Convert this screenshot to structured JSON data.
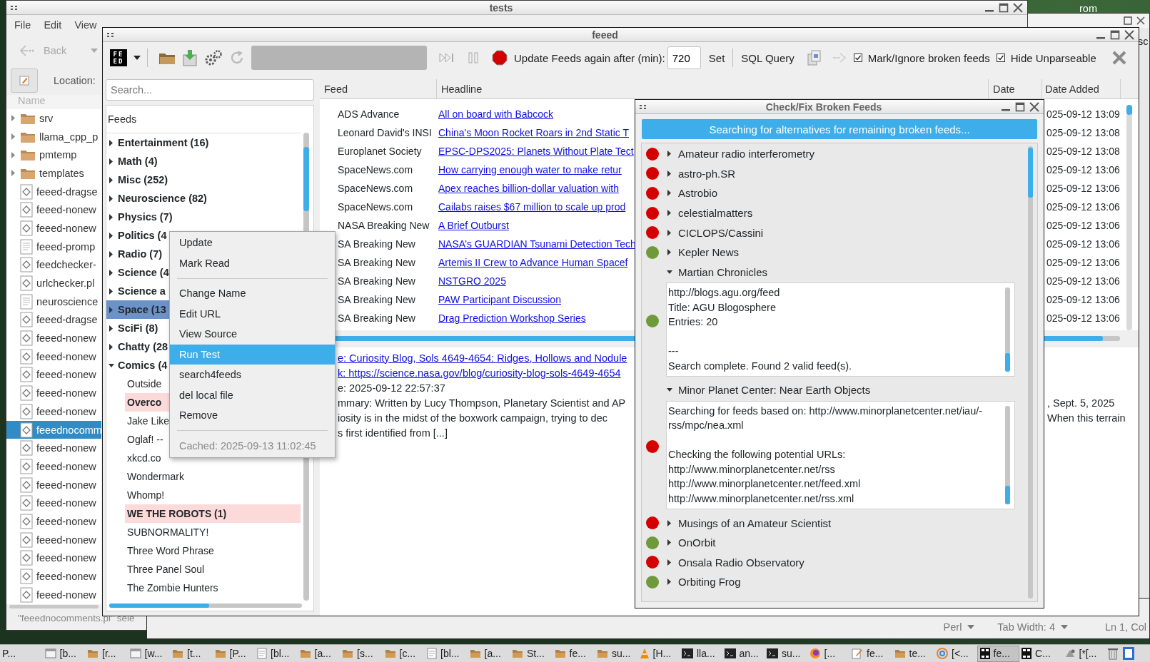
{
  "desktop": {
    "labels": [
      "rom",
      "sc"
    ]
  },
  "file_manager": {
    "title": "tests",
    "menu": [
      "File",
      "Edit",
      "View"
    ],
    "back_label": "Back",
    "location_label": "Location:",
    "column": "Name",
    "status": "\"feeednocomments.pl\" sele",
    "files": [
      {
        "name": "srv",
        "kind": "folder",
        "selected": false
      },
      {
        "name": "llama_cpp_p",
        "kind": "folder",
        "selected": false
      },
      {
        "name": "pmtemp",
        "kind": "folder",
        "selected": false
      },
      {
        "name": "templates",
        "kind": "folder",
        "selected": false
      },
      {
        "name": "feeed-dragse",
        "kind": "script",
        "selected": false
      },
      {
        "name": "feeed-nonew",
        "kind": "script",
        "selected": false
      },
      {
        "name": "feeed-nonew",
        "kind": "script",
        "selected": false
      },
      {
        "name": "feeed-promp",
        "kind": "text",
        "selected": false
      },
      {
        "name": "feedchecker-",
        "kind": "script",
        "selected": false
      },
      {
        "name": "urlchecker.pl",
        "kind": "script",
        "selected": false
      },
      {
        "name": "neuroscience",
        "kind": "text",
        "selected": false
      },
      {
        "name": "feeed-dragse",
        "kind": "script",
        "selected": false
      },
      {
        "name": "feeed-nonew",
        "kind": "script",
        "selected": false
      },
      {
        "name": "feeed-nonew",
        "kind": "script",
        "selected": false
      },
      {
        "name": "feeed-nonew",
        "kind": "script",
        "selected": false
      },
      {
        "name": "feeed-nonew",
        "kind": "script",
        "selected": false
      },
      {
        "name": "feeed-nonew",
        "kind": "script",
        "selected": false
      },
      {
        "name": "feeednocomm",
        "kind": "script",
        "selected": true
      },
      {
        "name": "feeed-nonew",
        "kind": "script",
        "selected": false
      },
      {
        "name": "feeed-nonew",
        "kind": "script",
        "selected": false
      },
      {
        "name": "feeed-nonew",
        "kind": "script",
        "selected": false
      },
      {
        "name": "feeed-nonew",
        "kind": "script",
        "selected": false
      },
      {
        "name": "feeed-nonew",
        "kind": "script",
        "selected": false
      },
      {
        "name": "feeed-nonew",
        "kind": "script",
        "selected": false
      },
      {
        "name": "feeed-nonew",
        "kind": "script",
        "selected": false
      },
      {
        "name": "feeed-nonew",
        "kind": "script",
        "selected": false
      },
      {
        "name": "feeed-nonew",
        "kind": "script",
        "selected": false
      }
    ]
  },
  "editor": {
    "syntax": "Perl",
    "tab_width": "Tab Width: 4",
    "cursor": "Ln 1, Col"
  },
  "feeed": {
    "title": "feeed",
    "logo": [
      "FE",
      "ED"
    ],
    "update_label": "Update Feeds again after (min):",
    "interval": "720",
    "set_button": "Set",
    "sql_button": "SQL Query",
    "checkboxes": [
      {
        "label": "Mark/Ignore broken feeds",
        "checked": true
      },
      {
        "label": "Hide Unparseable",
        "checked": true
      }
    ],
    "search": {
      "placeholder": "Search..."
    },
    "tree_header": "Feeds",
    "categories": [
      {
        "label": "Entertainment (16)",
        "expanded": false,
        "selected": false
      },
      {
        "label": "Math (4)",
        "expanded": false,
        "selected": false
      },
      {
        "label": "Misc (252)",
        "expanded": false,
        "selected": false
      },
      {
        "label": "Neuroscience (82)",
        "expanded": false,
        "selected": false
      },
      {
        "label": "Physics (7)",
        "expanded": false,
        "selected": false
      },
      {
        "label": "Politics (4",
        "expanded": false,
        "selected": false
      },
      {
        "label": "Radio (7)",
        "expanded": false,
        "selected": false
      },
      {
        "label": "Science (4",
        "expanded": false,
        "selected": false
      },
      {
        "label": "Science a",
        "expanded": false,
        "selected": false
      },
      {
        "label": "Space (13",
        "expanded": false,
        "selected": true
      },
      {
        "label": "SciFi (8)",
        "expanded": false,
        "selected": false
      },
      {
        "label": "Chatty (28",
        "expanded": false,
        "selected": false
      },
      {
        "label": "Comics (4",
        "expanded": true,
        "selected": false,
        "children": [
          {
            "label": "Outside",
            "unread": false,
            "flagged": false,
            "selected": false
          },
          {
            "label": "Overco",
            "unread": true,
            "flagged": true,
            "selected": false
          },
          {
            "label": "Jake Like",
            "unread": false,
            "flagged": false,
            "selected": false
          },
          {
            "label": "Oglaf! --",
            "unread": false,
            "flagged": false,
            "selected": false
          },
          {
            "label": "xkcd.co",
            "unread": false,
            "flagged": false,
            "selected": false
          },
          {
            "label": "Wondermark",
            "unread": false,
            "flagged": false,
            "selected": false
          },
          {
            "label": "Whomp!",
            "unread": false,
            "flagged": false,
            "selected": false
          },
          {
            "label": "WE THE ROBOTS (1)",
            "unread": true,
            "flagged": true,
            "selected": false
          },
          {
            "label": "SUBNORMALITY!",
            "unread": false,
            "flagged": false,
            "selected": false
          },
          {
            "label": "Three Word Phrase",
            "unread": false,
            "flagged": false,
            "selected": false
          },
          {
            "label": "Three Panel Soul",
            "unread": false,
            "flagged": false,
            "selected": false
          },
          {
            "label": "The Zombie Hunters",
            "unread": false,
            "flagged": false,
            "selected": false
          }
        ]
      }
    ],
    "columns": [
      "Feed",
      "Headline",
      "Date",
      "Date Added"
    ],
    "rows": [
      {
        "feed": "ADS Advance",
        "headline": "All on board with Babcock",
        "date_added": "025-09-12 13:09"
      },
      {
        "feed": "Leonard David's INSI",
        "headline": "China's Moon Rocket Roars in 2nd Static T",
        "date_added": "025-09-12 13:08"
      },
      {
        "feed": "Europlanet Society",
        "headline": "EPSC-DPS2025: Planets Without Plate Tect",
        "date_added": "025-09-12 13:08"
      },
      {
        "feed": "SpaceNews.com",
        "headline": "How carrying enough water to make retur",
        "date_added": "025-09-12 13:06"
      },
      {
        "feed": "SpaceNews.com",
        "headline": "Apex reaches billion-dollar valuation with",
        "date_added": "025-09-12 13:06"
      },
      {
        "feed": "SpaceNews.com",
        "headline": "Cailabs raises $67 million to scale up prod",
        "date_added": "025-09-12 13:06"
      },
      {
        "feed": "NASA Breaking New",
        "headline": "A Brief Outburst",
        "date_added": "025-09-12 13:06"
      },
      {
        "feed": "SA Breaking New",
        "headline": "NASA’s GUARDIAN Tsunami Detection Tech",
        "date_added": "025-09-12 13:06"
      },
      {
        "feed": "SA Breaking New",
        "headline": "Artemis II Crew to Advance Human Spacef",
        "date_added": "025-09-12 13:06"
      },
      {
        "feed": "SA Breaking New",
        "headline": "NSTGRO 2025",
        "date_added": "025-09-12 13:06"
      },
      {
        "feed": "SA Breaking New",
        "headline": "PAW Participant Discussion",
        "date_added": "025-09-12 13:06"
      },
      {
        "feed": "SA Breaking New",
        "headline": "Drag Prediction Workshop Series",
        "date_added": "025-09-12 13:06"
      }
    ],
    "details": [
      {
        "kind": "link",
        "text": "e: Curiosity Blog, Sols 4649-4654: Ridges, Hollows and Nodule"
      },
      {
        "kind": "link",
        "text": "k: https://science.nasa.gov/blog/curiosity-blog-sols-4649-4654"
      },
      {
        "kind": "text",
        "text": "e: 2025-09-12 22:57:37"
      },
      {
        "kind": "text",
        "text": "mmary: Written by Lucy Thompson, Planetary Scientist and AP",
        "continuation": ", Sept. 5, 2025"
      },
      {
        "kind": "text",
        "text": "iosity is in the midst of the boxwork campaign, trying to dec",
        "continuation": "When this terrain"
      },
      {
        "kind": "text",
        "text": "s first identified from [...]"
      }
    ]
  },
  "context_menu": {
    "items": [
      {
        "kind": "item",
        "label": "Update",
        "selected": false
      },
      {
        "kind": "item",
        "label": "Mark Read",
        "selected": false
      },
      {
        "kind": "separator"
      },
      {
        "kind": "item",
        "label": "Change Name",
        "selected": false
      },
      {
        "kind": "item",
        "label": "Edit URL",
        "selected": false
      },
      {
        "kind": "item",
        "label": "View Source",
        "selected": false
      },
      {
        "kind": "item",
        "label": "Run Test",
        "selected": true
      },
      {
        "kind": "item",
        "label": "search4feeds",
        "selected": false
      },
      {
        "kind": "item",
        "label": "del local file",
        "selected": false
      },
      {
        "kind": "item",
        "label": "Remove",
        "selected": false
      },
      {
        "kind": "separator"
      },
      {
        "kind": "info",
        "label": "Cached: 2025-09-13 11:02:45"
      }
    ]
  },
  "dialog": {
    "title": "Check/Fix Broken Feeds",
    "banner": "Searching for alternatives for remaining broken feeds...",
    "feeds": [
      {
        "name": "Amateur radio interferometry",
        "color": "#d40000",
        "expanded": false
      },
      {
        "name": "astro-ph.SR",
        "color": "#d40000",
        "expanded": false
      },
      {
        "name": "Astrobio",
        "color": "#d40000",
        "expanded": false
      },
      {
        "name": "celestialmatters",
        "color": "#d40000",
        "expanded": false
      },
      {
        "name": "CICLOPS/Cassini",
        "color": "#d40000",
        "expanded": false
      },
      {
        "name": "Kepler News",
        "color": "#6f9a3c",
        "expanded": false
      },
      {
        "name": "Martian Chronicles",
        "color": "#6f9a3c",
        "expanded": true,
        "details": "http://blogs.agu.org/feed\nTitle: AGU Blogosphere\nEntries: 20\n\n---\nSearch complete. Found 2 valid feed(s)."
      },
      {
        "name": "Minor Planet Center: Near Earth Objects",
        "color": "#d40000",
        "expanded": true,
        "details": "Searching for feeds based on: http://www.minorplanetcenter.net/iau/-rss/mpc/nea.xml\n\nChecking the following potential URLs:\nhttp://www.minorplanetcenter.net/rss\nhttp://www.minorplanetcenter.net/feed.xml\nhttp://www.minorplanetcenter.net/rss.xml"
      },
      {
        "name": "Musings of an Amateur Scientist",
        "color": "#d40000",
        "expanded": false
      },
      {
        "name": "OnOrbit",
        "color": "#6f9a3c",
        "expanded": false
      },
      {
        "name": "Onsala Radio Observatory",
        "color": "#d40000",
        "expanded": false
      },
      {
        "name": "Orbiting Frog",
        "color": "#6f9a3c",
        "expanded": false
      }
    ]
  },
  "taskbar": {
    "items": [
      {
        "label": "P...",
        "kind": "plain",
        "selected": false
      },
      {
        "label": "[b...",
        "kind": "window",
        "selected": false
      },
      {
        "label": "[r...",
        "kind": "folder",
        "selected": false
      },
      {
        "label": "[w...",
        "kind": "window",
        "selected": false
      },
      {
        "label": "[t...",
        "kind": "folder",
        "selected": false
      },
      {
        "label": "[P...",
        "kind": "folder",
        "selected": false
      },
      {
        "label": "[bl...",
        "kind": "document",
        "selected": false
      },
      {
        "label": "[a...",
        "kind": "folder",
        "selected": false
      },
      {
        "label": "[s...",
        "kind": "folder",
        "selected": false
      },
      {
        "label": "[c...",
        "kind": "folder",
        "selected": false
      },
      {
        "label": "[bl...",
        "kind": "document",
        "selected": false
      },
      {
        "label": "[a...",
        "kind": "folder",
        "selected": false
      },
      {
        "label": "St...",
        "kind": "folder",
        "selected": false
      },
      {
        "label": "fe...",
        "kind": "folder",
        "selected": false
      },
      {
        "label": "su...",
        "kind": "folder",
        "selected": false
      },
      {
        "label": "[H...",
        "kind": "cone",
        "selected": false
      },
      {
        "label": "lla...",
        "kind": "terminal",
        "selected": false
      },
      {
        "label": "an...",
        "kind": "terminal",
        "selected": false
      },
      {
        "label": "su...",
        "kind": "terminal",
        "selected": false
      },
      {
        "label": "[...",
        "kind": "browser",
        "selected": false
      },
      {
        "label": "fe...",
        "kind": "notepad",
        "selected": false
      },
      {
        "label": "te...",
        "kind": "folder",
        "selected": false
      },
      {
        "label": "[<...",
        "kind": "spiral",
        "selected": false
      },
      {
        "label": "fe...",
        "kind": "logo",
        "selected": true
      },
      {
        "label": "C...",
        "kind": "logo",
        "selected": false
      },
      {
        "label": "[*[...",
        "kind": "app",
        "selected": false
      }
    ]
  }
}
